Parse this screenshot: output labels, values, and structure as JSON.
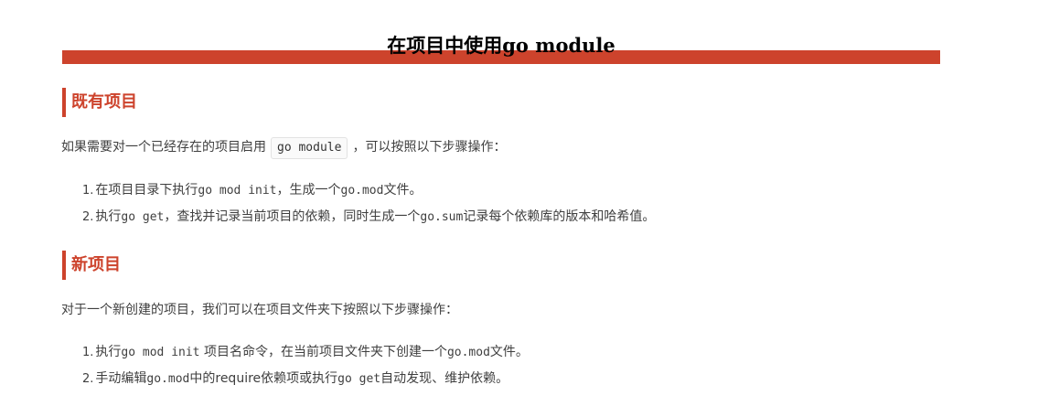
{
  "article": {
    "title": "在项目中使用go module"
  },
  "colors": {
    "accent": "#cd432c",
    "text": "#3f3f3f"
  },
  "existing_project": {
    "heading": "既有项目",
    "intro_before": "如果需要对一个已经存在的项目启用",
    "intro_code": "go module",
    "intro_after": "，可以按照以下步骤操作：",
    "steps": [
      {
        "number": "1.",
        "text_before": "在项目目录下执行",
        "code": "go mod init",
        "text_middle": "，生成一个",
        "code2": "go.mod",
        "text_after": "文件。"
      },
      {
        "number": "2.",
        "text_before": "执行",
        "code": "go get",
        "text_middle": "，查找并记录当前项目的依赖，同时生成一个",
        "code2": "go.sum",
        "text_after": "记录每个依赖库的版本和哈希值。"
      }
    ]
  },
  "new_project": {
    "heading": "新项目",
    "intro": "对于一个新创建的项目，我们可以在项目文件夹下按照以下步骤操作：",
    "steps": [
      {
        "number": "1.",
        "text_before": "执行",
        "code": "go mod init",
        "text_middle": " 项目名命令，在当前项目文件夹下创建一个",
        "code2": "go.mod",
        "text_after": "文件。"
      },
      {
        "number": "2.",
        "text_before": "手动编辑",
        "code": "go.mod",
        "text_middle": "中的require依赖项或执行",
        "code2": "go get",
        "text_after": "自动发现、维护依赖。"
      }
    ]
  }
}
